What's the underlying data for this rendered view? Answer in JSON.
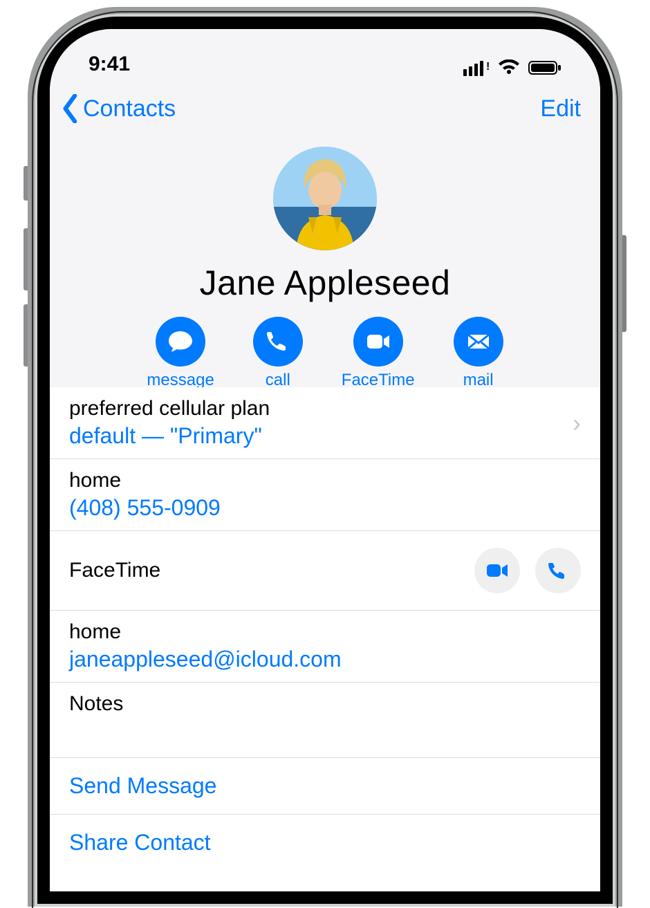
{
  "status": {
    "time": "9:41",
    "cellular_icon": "cellular-signal-icon",
    "wifi_icon": "wifi-icon",
    "battery_icon": "battery-icon"
  },
  "nav": {
    "back_label": "Contacts",
    "edit_label": "Edit"
  },
  "contact": {
    "name": "Jane Appleseed"
  },
  "actions": {
    "message": "message",
    "call": "call",
    "facetime": "FaceTime",
    "mail": "mail"
  },
  "rows": {
    "preferred_plan_label": "preferred cellular plan",
    "preferred_plan_value": "default — \"Primary\"",
    "phone_label": "home",
    "phone_value": "(408) 555-0909",
    "facetime_label": "FaceTime",
    "email_label": "home",
    "email_value": "janeappleseed@icloud.com",
    "notes_label": "Notes",
    "send_message": "Send Message",
    "share_contact": "Share Contact"
  }
}
